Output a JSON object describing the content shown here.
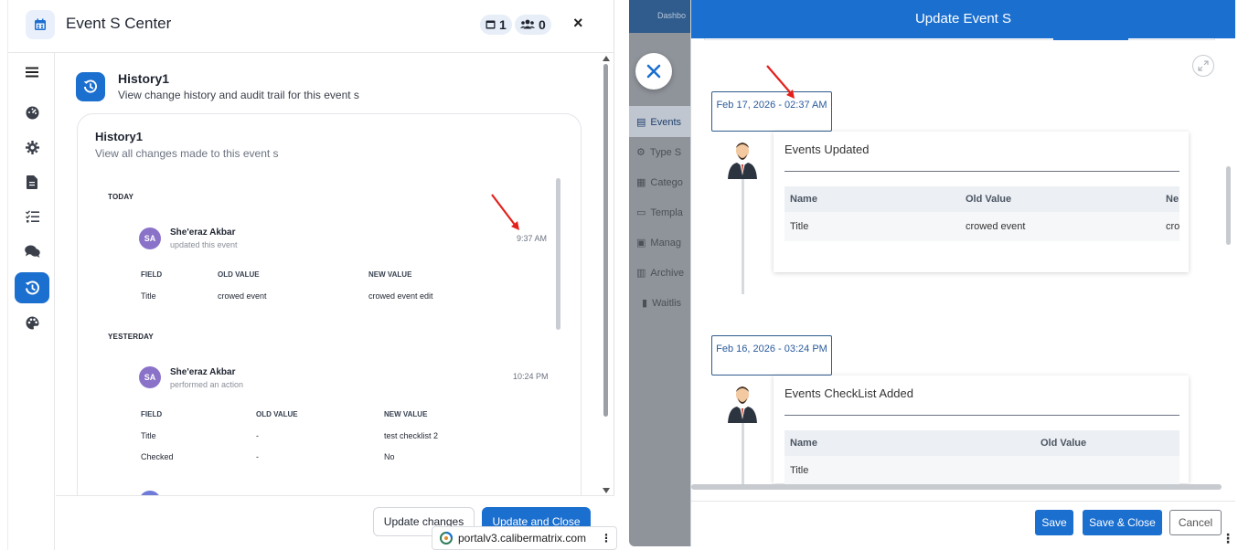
{
  "left_panel": {
    "title": "Event S Center",
    "badge_calendar_count": "1",
    "badge_people_count": "0",
    "close": "×",
    "section_title": "History1",
    "section_subtitle": "View change history and audit trail for this event s",
    "card_title": "History1",
    "card_subtitle": "View all changes made to this event s",
    "groups": [
      {
        "day": "TODAY",
        "initials": "SA",
        "user": "She'eraz Akbar",
        "action": "updated this event",
        "time": "9:37 AM",
        "headers": [
          "FIELD",
          "OLD VALUE",
          "NEW VALUE"
        ],
        "rows": [
          [
            "Title",
            "crowed event",
            "crowed event edit"
          ]
        ]
      },
      {
        "day": "YESTERDAY",
        "initials": "SA",
        "user": "She'eraz Akbar",
        "action": "performed an action",
        "time": "10:24 PM",
        "headers": [
          "FIELD",
          "OLD VALUE",
          "NEW VALUE"
        ],
        "rows": [
          [
            "Title",
            "-",
            "test checklist 2"
          ],
          [
            "Checked",
            "-",
            "No"
          ]
        ]
      }
    ],
    "buttons": {
      "update_changes": "Update changes",
      "update_and_close": "Update and Close"
    }
  },
  "browser": {
    "url": "portalv3.calibermatrix.com"
  },
  "right_panel": {
    "backdrop_nav": {
      "top": "Dashbo",
      "items": [
        "Events",
        "Type S",
        "Catego",
        "Templa",
        "Manag",
        "Archive",
        "Waitlis"
      ]
    },
    "modal_title": "Update Event S",
    "entries": [
      {
        "date": "Feb 17, 2026 - 02:37 AM",
        "title": "Events Updated",
        "headers": [
          "Name",
          "Old Value",
          "Ne"
        ],
        "row": [
          "Title",
          "crowed event",
          "cro"
        ]
      },
      {
        "date": "Feb 16, 2026 - 03:24 PM",
        "title": "Events CheckList Added",
        "headers": [
          "Name",
          "Old Value",
          ""
        ],
        "row": [
          "Title",
          "",
          ""
        ]
      }
    ],
    "buttons": {
      "save": "Save",
      "save_close": "Save & Close",
      "cancel": "Cancel"
    }
  },
  "colors": {
    "primary": "#1b6fcf",
    "avatar": "#8b72c9",
    "annotation_arrow": "#e3201b"
  }
}
